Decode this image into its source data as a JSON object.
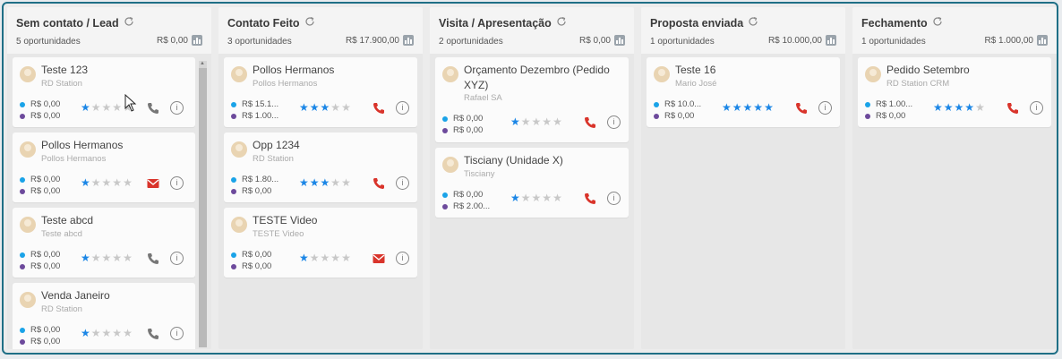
{
  "columns": [
    {
      "title": "Sem contato / Lead",
      "count": "5 oportunidades",
      "total": "R$ 0,00",
      "cards": [
        {
          "title": "Teste 123",
          "sub": "RD Station",
          "v1": "R$ 0,00",
          "v2": "R$ 0,00",
          "stars": 1,
          "action": "phone-gray"
        },
        {
          "title": "Pollos Hermanos",
          "sub": "Pollos Hermanos",
          "v1": "R$ 0,00",
          "v2": "R$ 0,00",
          "stars": 1,
          "action": "email"
        },
        {
          "title": "Teste abcd",
          "sub": "Teste abcd",
          "v1": "R$ 0,00",
          "v2": "R$ 0,00",
          "stars": 1,
          "action": "phone-gray"
        },
        {
          "title": "Venda Janeiro",
          "sub": "RD Station",
          "v1": "R$ 0,00",
          "v2": "R$ 0,00",
          "stars": 1,
          "action": "phone-gray"
        }
      ]
    },
    {
      "title": "Contato Feito",
      "count": "3 oportunidades",
      "total": "R$ 17.900,00",
      "cards": [
        {
          "title": "Pollos Hermanos",
          "sub": "Pollos Hermanos",
          "v1": "R$ 15.1...",
          "v2": "R$ 1.00...",
          "stars": 3,
          "action": "phone"
        },
        {
          "title": "Opp 1234",
          "sub": "RD Station",
          "v1": "R$ 1.80...",
          "v2": "R$ 0,00",
          "stars": 3,
          "action": "phone"
        },
        {
          "title": "TESTE Video",
          "sub": "TESTE Video",
          "v1": "R$ 0,00",
          "v2": "R$ 0,00",
          "stars": 1,
          "action": "email"
        }
      ]
    },
    {
      "title": "Visita / Apresentação",
      "count": "2 oportunidades",
      "total": "R$ 0,00",
      "cards": [
        {
          "title": "Orçamento Dezembro (Pedido XYZ)",
          "sub": "Rafael SA",
          "v1": "R$ 0,00",
          "v2": "R$ 0,00",
          "stars": 1,
          "action": "phone"
        },
        {
          "title": "Tisciany (Unidade X)",
          "sub": "Tisciany",
          "v1": "R$ 0,00",
          "v2": "R$ 2.00...",
          "stars": 1,
          "action": "phone"
        }
      ]
    },
    {
      "title": "Proposta enviada",
      "count": "1 oportunidades",
      "total": "R$ 10.000,00",
      "cards": [
        {
          "title": "Teste 16",
          "sub": "Mario José",
          "v1": "R$ 10.0...",
          "v2": "R$ 0,00",
          "stars": 5,
          "action": "phone"
        }
      ]
    },
    {
      "title": "Fechamento",
      "count": "1 oportunidades",
      "total": "R$ 1.000,00",
      "cards": [
        {
          "title": "Pedido Setembro",
          "sub": "RD Station CRM",
          "v1": "R$ 1.00...",
          "v2": "R$ 0,00",
          "stars": 4,
          "action": "phone"
        }
      ]
    }
  ],
  "icons": {
    "refresh": "refresh-icon",
    "chart": "chart-icon",
    "phone": "phone-icon",
    "email": "email-icon",
    "info": "info-icon",
    "star": "star-icon",
    "avatar": "avatar"
  },
  "colors": {
    "frame": "#1f6f86",
    "star_on": "#1b86e6",
    "phone_red": "#d9342b",
    "phone_gray": "#777777",
    "email_red": "#d9342b",
    "dot_blue": "#1aa3e8",
    "dot_purple": "#6d4a9c"
  }
}
